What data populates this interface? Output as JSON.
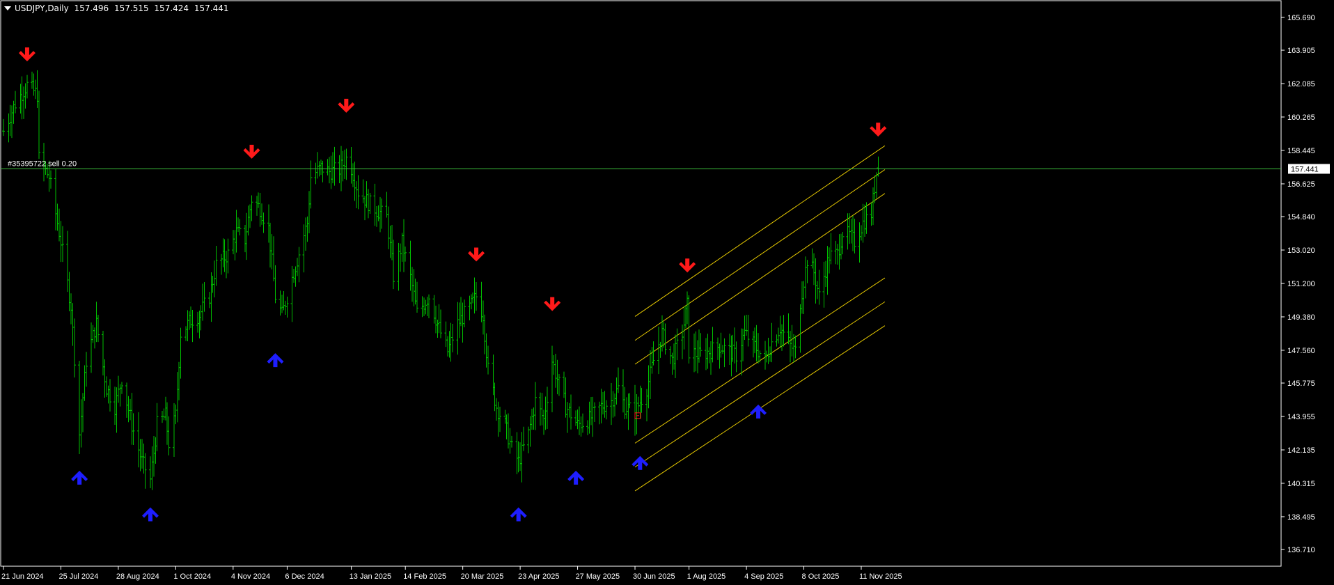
{
  "header": {
    "symbol": "USDJPY",
    "timeframe": "Daily",
    "ohlc": [
      "157.496",
      "157.515",
      "157.424",
      "157.441"
    ]
  },
  "order": {
    "label": "#35395722 sell 0.20"
  },
  "chart_data": {
    "type": "bar",
    "symbol": "USDJPY",
    "timeframe": "Daily",
    "bar_color": "#00c000",
    "background": "#000000",
    "price_line": {
      "value": 157.441,
      "label": "157.441",
      "color": "#3cbf3c"
    },
    "ylim": [
      135.8,
      166.6
    ],
    "y_ticks": [
      {
        "v": 165.69,
        "l": "165.690"
      },
      {
        "v": 163.905,
        "l": "163.905"
      },
      {
        "v": 162.085,
        "l": "162.085"
      },
      {
        "v": 160.265,
        "l": "160.265"
      },
      {
        "v": 158.445,
        "l": "158.445"
      },
      {
        "v": 156.625,
        "l": "156.625"
      },
      {
        "v": 154.84,
        "l": "154.840"
      },
      {
        "v": 153.02,
        "l": "153.020"
      },
      {
        "v": 151.2,
        "l": "151.200"
      },
      {
        "v": 149.38,
        "l": "149.380"
      },
      {
        "v": 147.56,
        "l": "147.560"
      },
      {
        "v": 145.775,
        "l": "145.775"
      },
      {
        "v": 143.955,
        "l": "143.955"
      },
      {
        "v": 142.135,
        "l": "142.135"
      },
      {
        "v": 140.315,
        "l": "140.315"
      },
      {
        "v": 138.495,
        "l": "138.495"
      },
      {
        "v": 136.71,
        "l": "136.710"
      }
    ],
    "x_ticks": [
      "21 Jun 2024",
      "25 Jul 2024",
      "28 Aug 2024",
      "1 Oct 2024",
      "4 Nov 2024",
      "6 Dec 2024",
      "13 Jan 2025",
      "14 Feb 2025",
      "20 Mar 2025",
      "23 Apr 2025",
      "27 May 2025",
      "30 Jun 2025",
      "1 Aug 2025",
      "4 Sep 2025",
      "8 Oct 2025",
      "11 Nov 2025"
    ],
    "anchors": [
      [
        "21 Jun 2024",
        159.5
      ],
      [
        "28 Jun 2024",
        161.0
      ],
      [
        "5 Jul 2024",
        162.0
      ],
      [
        "11 Jul 2024",
        161.5
      ],
      [
        "12 Jul 2024",
        158.0
      ],
      [
        "18 Jul 2024",
        157.0
      ],
      [
        "25 Jul 2024",
        153.5
      ],
      [
        "31 Jul 2024",
        150.0
      ],
      [
        "5 Aug 2024",
        143.0
      ],
      [
        "9 Aug 2024",
        147.0
      ],
      [
        "15 Aug 2024",
        149.0
      ],
      [
        "21 Aug 2024",
        145.5
      ],
      [
        "26 Aug 2024",
        144.5
      ],
      [
        "30 Aug 2024",
        146.0
      ],
      [
        "5 Sep 2024",
        143.5
      ],
      [
        "11 Sep 2024",
        141.5
      ],
      [
        "16 Sep 2024",
        140.5
      ],
      [
        "20 Sep 2024",
        143.5
      ],
      [
        "25 Sep 2024",
        144.0
      ],
      [
        "27 Sep 2024",
        142.5
      ],
      [
        "1 Oct 2024",
        144.0
      ],
      [
        "4 Oct 2024",
        148.5
      ],
      [
        "10 Oct 2024",
        149.2
      ],
      [
        "15 Oct 2024",
        149.5
      ],
      [
        "21 Oct 2024",
        150.5
      ],
      [
        "25 Oct 2024",
        152.2
      ],
      [
        "1 Nov 2024",
        152.8
      ],
      [
        "6 Nov 2024",
        154.0
      ],
      [
        "11 Nov 2024",
        153.6
      ],
      [
        "15 Nov 2024",
        155.8
      ],
      [
        "20 Nov 2024",
        155.3
      ],
      [
        "25 Nov 2024",
        154.2
      ],
      [
        "29 Nov 2024",
        150.5
      ],
      [
        "3 Dec 2024",
        149.5
      ],
      [
        "6 Dec 2024",
        150.5
      ],
      [
        "12 Dec 2024",
        152.5
      ],
      [
        "18 Dec 2024",
        154.5
      ],
      [
        "20 Dec 2024",
        157.0
      ],
      [
        "26 Dec 2024",
        157.5
      ],
      [
        "31 Dec 2024",
        157.3
      ],
      [
        "6 Jan 2025",
        157.4
      ],
      [
        "10 Jan 2025",
        158.0
      ],
      [
        "13 Jan 2025",
        157.5
      ],
      [
        "17 Jan 2025",
        156.2
      ],
      [
        "23 Jan 2025",
        155.6
      ],
      [
        "28 Jan 2025",
        155.2
      ],
      [
        "3 Feb 2025",
        154.8
      ],
      [
        "7 Feb 2025",
        151.6
      ],
      [
        "12 Feb 2025",
        153.4
      ],
      [
        "17 Feb 2025",
        151.5
      ],
      [
        "21 Feb 2025",
        149.6
      ],
      [
        "28 Feb 2025",
        150.5
      ],
      [
        "5 Mar 2025",
        149.0
      ],
      [
        "11 Mar 2025",
        147.5
      ],
      [
        "17 Mar 2025",
        149.0
      ],
      [
        "25 Mar 2025",
        150.0
      ],
      [
        "28 Mar 2025",
        150.5
      ],
      [
        "1 Apr 2025",
        149.5
      ],
      [
        "4 Apr 2025",
        146.5
      ],
      [
        "9 Apr 2025",
        144.5
      ],
      [
        "14 Apr 2025",
        143.5
      ],
      [
        "18 Apr 2025",
        142.2
      ],
      [
        "22 Apr 2025",
        141.5
      ],
      [
        "28 Apr 2025",
        143.0
      ],
      [
        "2 May 2025",
        144.8
      ],
      [
        "7 May 2025",
        143.8
      ],
      [
        "12 May 2025",
        147.0
      ],
      [
        "15 May 2025",
        146.0
      ],
      [
        "20 May 2025",
        144.5
      ],
      [
        "27 May 2025",
        143.5
      ],
      [
        "3 Jun 2025",
        143.8
      ],
      [
        "10 Jun 2025",
        144.5
      ],
      [
        "16 Jun 2025",
        144.8
      ],
      [
        "20 Jun 2025",
        145.5
      ],
      [
        "24 Jun 2025",
        144.5
      ],
      [
        "30 Jun 2025",
        144.2
      ],
      [
        "7 Jul 2025",
        145.5
      ],
      [
        "11 Jul 2025",
        147.0
      ],
      [
        "16 Jul 2025",
        148.5
      ],
      [
        "22 Jul 2025",
        147.0
      ],
      [
        "28 Jul 2025",
        148.5
      ],
      [
        "31 Jul 2025",
        150.0
      ],
      [
        "1 Aug 2025",
        147.5
      ],
      [
        "7 Aug 2025",
        147.3
      ],
      [
        "13 Aug 2025",
        147.5
      ],
      [
        "19 Aug 2025",
        147.8
      ],
      [
        "25 Aug 2025",
        147.5
      ],
      [
        "29 Aug 2025",
        147.3
      ],
      [
        "3 Sep 2025",
        148.5
      ],
      [
        "9 Sep 2025",
        147.8
      ],
      [
        "15 Sep 2025",
        147.0
      ],
      [
        "19 Sep 2025",
        148.0
      ],
      [
        "24 Sep 2025",
        148.8
      ],
      [
        "30 Sep 2025",
        147.8
      ],
      [
        "3 Oct 2025",
        147.5
      ],
      [
        "6 Oct 2025",
        150.2
      ],
      [
        "10 Oct 2025",
        152.5
      ],
      [
        "14 Oct 2025",
        151.8
      ],
      [
        "17 Oct 2025",
        150.5
      ],
      [
        "23 Oct 2025",
        152.7
      ],
      [
        "28 Oct 2025",
        152.8
      ],
      [
        "31 Oct 2025",
        154.0
      ],
      [
        "4 Nov 2025",
        153.8
      ],
      [
        "7 Nov 2025",
        153.5
      ],
      [
        "12 Nov 2025",
        154.5
      ],
      [
        "17 Nov 2025",
        155.0
      ],
      [
        "20 Nov 2025",
        157.2
      ],
      [
        "21 Nov 2025",
        157.5
      ]
    ],
    "last_bar": {
      "date": "21 Nov 2025",
      "open": 157.496,
      "high": 157.515,
      "low": 157.424,
      "close": 157.441
    },
    "down_arrows": [
      {
        "date": "5 Jul 2024",
        "price": 163.6
      },
      {
        "date": "15 Nov 2024",
        "price": 158.3
      },
      {
        "date": "10 Jan 2025",
        "price": 160.8
      },
      {
        "date": "28 Mar 2025",
        "price": 152.7
      },
      {
        "date": "12 May 2025",
        "price": 150.0
      },
      {
        "date": "31 Jul 2025",
        "price": 152.1
      },
      {
        "date": "21 Nov 2025",
        "price": 159.5
      }
    ],
    "up_arrows": [
      {
        "date": "5 Aug 2024",
        "price": 140.7
      },
      {
        "date": "16 Sep 2024",
        "price": 138.7
      },
      {
        "date": "29 Nov 2024",
        "price": 147.1
      },
      {
        "date": "22 Apr 2025",
        "price": 138.7
      },
      {
        "date": "26 May 2025",
        "price": 140.7
      },
      {
        "date": "3 Jul 2025",
        "price": 141.5
      },
      {
        "date": "11 Sep 2025",
        "price": 144.3
      }
    ],
    "down_arrow_color": "#ff1a1a",
    "up_arrow_color": "#1e1eff",
    "channel_lines": {
      "color": "#e5c800",
      "start_date": "30 Jun 2025",
      "end_date": "25 Nov 2025",
      "lines": [
        [
          149.4,
          158.7
        ],
        [
          148.1,
          157.4
        ],
        [
          146.8,
          156.1
        ],
        [
          142.5,
          151.5
        ],
        [
          141.2,
          150.2
        ],
        [
          139.9,
          148.9
        ]
      ]
    },
    "marker": {
      "date": "30 Jun 2025",
      "price": 144.0,
      "color": "#ff1a1a"
    }
  }
}
